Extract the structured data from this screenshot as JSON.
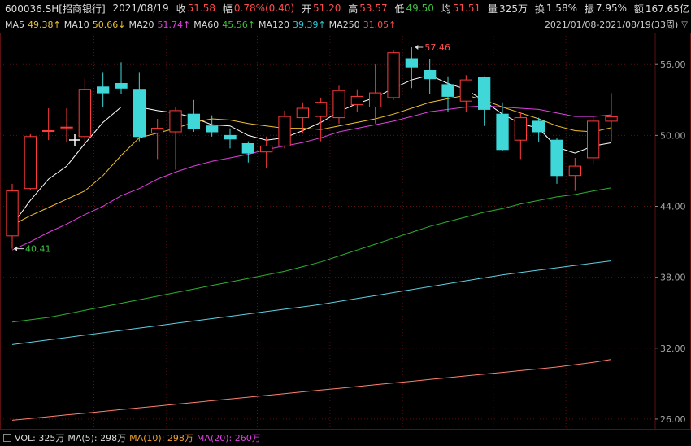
{
  "header": {
    "code": "600036.SH[招商银行]",
    "date": "2021/08/19",
    "close_label": "收",
    "close_value": "51.58",
    "change_label": "幅",
    "change_value": "0.78%(0.40)",
    "open_label": "开",
    "open_value": "51.20",
    "high_label": "高",
    "high_value": "53.57",
    "low_label": "低",
    "low_value": "49.50",
    "avg_label": "均",
    "avg_value": "51.51",
    "volume_label": "量",
    "volume_value": "325万",
    "turnover_label": "换",
    "turnover_value": "1.58%",
    "amplitude_label": "振",
    "amplitude_value": "7.95%",
    "amount_label": "额",
    "amount_value": "167.65亿"
  },
  "ma_bar": {
    "ma5_label": "MA5",
    "ma5_value": "49.38↑",
    "ma10_label": "MA10",
    "ma10_value": "50.66↓",
    "ma20_label": "MA20",
    "ma20_value": "51.74↑",
    "ma60_label": "MA60",
    "ma60_value": "45.56↑",
    "ma120_label": "MA120",
    "ma120_value": "39.39↑",
    "ma250_label": "MA250",
    "ma250_value": "31.05↑"
  },
  "range": "2021/01/08-2021/08/19(33周)",
  "volume_bar": {
    "vol": "VOL: 325万",
    "ma5": "MA(5): 298万",
    "ma10": "MA(10): 298万",
    "ma20": "MA(20): 260万"
  },
  "colors": {
    "up": "#ff3b3b",
    "down": "#3fd7d8",
    "ma5": "#ffffff",
    "ma10": "#f0c030",
    "ma20": "#e040e0",
    "ma60": "#2fb02f",
    "ma120": "#5fd0e0",
    "ma250": "#ff8070",
    "grid": "#5a1010",
    "axis_text": "#aaaaaa"
  },
  "chart_data": {
    "type": "candlestick",
    "y_ticks": [
      "56.00",
      "50.00",
      "44.00",
      "38.00",
      "32.00",
      "26.00"
    ],
    "ylim": [
      25.1,
      58.7
    ],
    "annotations": {
      "high": "57.46",
      "low": "40.41"
    },
    "candles": [
      [
        41.5,
        45.3,
        45.9,
        40.41
      ],
      [
        45.5,
        49.9,
        50.1,
        45.4
      ],
      [
        50.4,
        50.4,
        52.3,
        49.6
      ],
      [
        50.7,
        50.7,
        52.3,
        49.4
      ],
      [
        49.9,
        53.9,
        54.8,
        49.3
      ],
      [
        54.1,
        53.6,
        55.3,
        52.4
      ],
      [
        54.4,
        54.0,
        56.2,
        53.5
      ],
      [
        53.9,
        49.9,
        55.3,
        49.5
      ],
      [
        50.2,
        50.6,
        51.4,
        48.0
      ],
      [
        50.3,
        52.1,
        52.4,
        47.1
      ],
      [
        51.8,
        50.6,
        53.0,
        50.3
      ],
      [
        50.8,
        50.3,
        51.7,
        49.9
      ],
      [
        50.0,
        49.7,
        50.6,
        48.9
      ],
      [
        49.3,
        48.5,
        49.5,
        47.7
      ],
      [
        48.6,
        49.1,
        49.9,
        47.2
      ],
      [
        49.1,
        51.6,
        52.1,
        48.9
      ],
      [
        51.5,
        52.3,
        52.8,
        50.2
      ],
      [
        51.6,
        52.8,
        53.2,
        49.5
      ],
      [
        51.5,
        53.8,
        54.2,
        51.0
      ],
      [
        52.6,
        53.3,
        53.9,
        52.0
      ],
      [
        52.4,
        53.6,
        56.0,
        51.0
      ],
      [
        53.2,
        57.0,
        57.2,
        53.0
      ],
      [
        56.5,
        55.8,
        57.46,
        54.0
      ],
      [
        55.5,
        54.8,
        56.5,
        53.5
      ],
      [
        54.3,
        53.3,
        55.0,
        52.0
      ],
      [
        52.9,
        54.7,
        55.1,
        52.0
      ],
      [
        54.9,
        52.2,
        55.0,
        50.8
      ],
      [
        51.8,
        48.8,
        52.8,
        48.7
      ],
      [
        49.6,
        51.5,
        52.0,
        48.0
      ],
      [
        51.2,
        50.3,
        51.5,
        49.4
      ],
      [
        49.6,
        46.6,
        49.8,
        45.9
      ],
      [
        46.6,
        47.4,
        48.1,
        45.3
      ],
      [
        48.1,
        51.2,
        51.6,
        47.6
      ],
      [
        51.2,
        51.58,
        53.57,
        49.5
      ]
    ],
    "ma_series": [
      {
        "name": "MA5",
        "values": [
          42.4,
          44.5,
          46.3,
          47.4,
          49.3,
          51.1,
          52.4,
          52.4,
          52.1,
          51.9,
          51.5,
          50.9,
          50.8,
          50.0,
          49.6,
          49.8,
          50.4,
          51.1,
          52.0,
          52.7,
          53.2,
          54.0,
          54.7,
          55.1,
          54.4,
          53.9,
          52.9,
          51.8,
          51.0,
          50.6,
          49.0,
          48.5,
          49.1,
          49.38
        ]
      },
      {
        "name": "MA10",
        "values": [
          42.4,
          43.2,
          43.9,
          44.6,
          45.3,
          46.6,
          48.3,
          49.8,
          50.2,
          50.6,
          51.1,
          51.4,
          51.3,
          51.0,
          50.8,
          50.6,
          50.6,
          50.5,
          50.8,
          51.1,
          51.4,
          51.8,
          52.3,
          52.8,
          53.1,
          53.4,
          53.0,
          52.4,
          51.9,
          51.4,
          50.8,
          50.4,
          50.3,
          50.66
        ]
      },
      {
        "name": "MA20",
        "values": [
          40.3,
          41.0,
          41.8,
          42.5,
          43.3,
          44.0,
          44.9,
          45.5,
          46.3,
          46.9,
          47.4,
          47.8,
          48.1,
          48.4,
          48.8,
          49.1,
          49.4,
          49.8,
          50.3,
          50.6,
          50.9,
          51.2,
          51.6,
          52.0,
          52.2,
          52.4,
          52.5,
          52.4,
          52.3,
          52.2,
          51.9,
          51.6,
          51.6,
          51.74
        ]
      },
      {
        "name": "MA60",
        "values": [
          34.2,
          34.4,
          34.6,
          34.9,
          35.2,
          35.5,
          35.8,
          36.1,
          36.4,
          36.7,
          37.0,
          37.3,
          37.6,
          37.9,
          38.2,
          38.5,
          38.9,
          39.3,
          39.8,
          40.3,
          40.8,
          41.3,
          41.8,
          42.3,
          42.7,
          43.1,
          43.5,
          43.8,
          44.2,
          44.5,
          44.8,
          45.0,
          45.3,
          45.56
        ]
      },
      {
        "name": "MA120",
        "values": [
          32.3,
          32.5,
          32.7,
          32.9,
          33.1,
          33.3,
          33.5,
          33.7,
          33.9,
          34.1,
          34.3,
          34.5,
          34.7,
          34.9,
          35.1,
          35.3,
          35.5,
          35.7,
          35.95,
          36.2,
          36.45,
          36.7,
          36.95,
          37.2,
          37.45,
          37.7,
          37.95,
          38.2,
          38.4,
          38.6,
          38.8,
          39.0,
          39.2,
          39.39
        ]
      },
      {
        "name": "MA250",
        "values": [
          25.9,
          26.05,
          26.2,
          26.35,
          26.5,
          26.65,
          26.8,
          26.95,
          27.1,
          27.25,
          27.4,
          27.55,
          27.7,
          27.85,
          28.0,
          28.15,
          28.3,
          28.45,
          28.6,
          28.75,
          28.9,
          29.05,
          29.2,
          29.35,
          29.5,
          29.65,
          29.8,
          29.95,
          30.1,
          30.25,
          30.4,
          30.6,
          30.8,
          31.05
        ]
      }
    ]
  }
}
